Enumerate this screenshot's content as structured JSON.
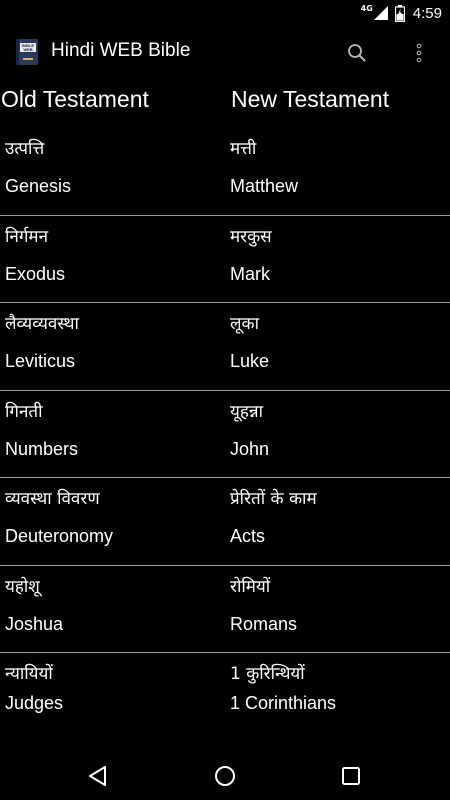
{
  "status_bar": {
    "network": "4G",
    "time": "4:59"
  },
  "app_bar": {
    "icon_text_top": "BIBLE",
    "icon_text_bottom": "WEB",
    "title": "Hindi WEB Bible",
    "search_icon": "search-icon",
    "overflow_icon": "more-vert-icon"
  },
  "headers": {
    "old": "Old Testament",
    "new": "New Testament"
  },
  "books": [
    {
      "old_hi": "उत्पत्ति",
      "old_en": "Genesis",
      "new_hi": "मत्ती",
      "new_en": "Matthew"
    },
    {
      "old_hi": "निर्गमन",
      "old_en": "Exodus",
      "new_hi": "मरकुस",
      "new_en": "Mark"
    },
    {
      "old_hi": "लैव्यव्यवस्था",
      "old_en": "Leviticus",
      "new_hi": "लूका",
      "new_en": "Luke"
    },
    {
      "old_hi": "गिनती",
      "old_en": "Numbers",
      "new_hi": "यूहन्ना",
      "new_en": "John"
    },
    {
      "old_hi": "व्यवस्था विवरण",
      "old_en": "Deuteronomy",
      "new_hi": "प्रेरितों के काम",
      "new_en": "Acts"
    },
    {
      "old_hi": "यहोशू",
      "old_en": "Joshua",
      "new_hi": "रोमियों",
      "new_en": "Romans"
    },
    {
      "old_hi": "न्यायियों",
      "old_en": "Judges",
      "new_hi": "1 कुरिन्थियों",
      "new_en": "1 Corinthians"
    }
  ],
  "nav_bar": {
    "back_icon": "back-icon",
    "home_icon": "home-icon",
    "recents_icon": "recents-icon"
  }
}
